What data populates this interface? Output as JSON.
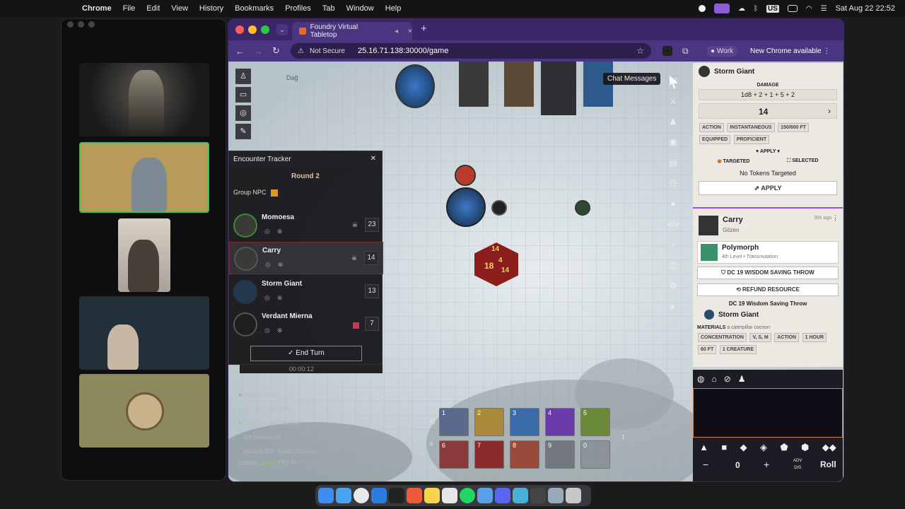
{
  "menubar": {
    "app": "Chrome",
    "items": [
      "File",
      "Edit",
      "View",
      "History",
      "Bookmarks",
      "Profiles",
      "Tab",
      "Window",
      "Help"
    ],
    "datetime": "Sat Aug 22  22:52",
    "input_source": "US"
  },
  "browser": {
    "tab_title": "Foundry Virtual Tabletop",
    "security": "Not Secure",
    "url": "25.16.71.138:30000/game",
    "profile": "Work",
    "update_label": "New Chrome available"
  },
  "tooltip": "Chat Messages",
  "encounter_tracker": {
    "title": "Encounter Tracker",
    "round": "Round 2",
    "group_label": "Group NPC",
    "combatants": [
      {
        "name": "Momoesa",
        "initiative": "23"
      },
      {
        "name": "Carry",
        "initiative": "14"
      },
      {
        "name": "Storm Giant",
        "initiative": "13"
      },
      {
        "name": "Verdant Mierna",
        "initiative": "7"
      }
    ],
    "end_turn": "End Turn"
  },
  "timer_text": "00:00:12",
  "players": [
    "Gözen [Carry]",
    "Gamemaster [GM]",
    "Enes [Verdant Mierna]",
    "Eril [Momoesa]",
    "Mustafa [Eril \"Koala\" Duncan]"
  ],
  "latency": {
    "label": "Latency",
    "value": "196ms",
    "fps_label": "FPS",
    "fps": "44"
  },
  "hotbar": {
    "top": [
      "1",
      "2",
      "3",
      "4",
      "5"
    ],
    "bottom": [
      "6",
      "7",
      "8",
      "9",
      "0"
    ],
    "page": "1"
  },
  "dice_faces": [
    "14",
    "18",
    "4",
    "14"
  ],
  "map_label": "Dağ",
  "chat": {
    "damage_card": {
      "title": "Storm Giant",
      "damage_label": "DAMAGE",
      "formula": "1d8 + 2 + 1 + 5 + 2",
      "total": "14",
      "tags1": [
        "ACTION",
        "INSTANTANEOUS",
        "150/600 FT"
      ],
      "tags2": [
        "EQUIPPED",
        "PROFICIENT"
      ],
      "apply_menu": "APPLY",
      "targeted": "TARGETED",
      "selected": "SELECTED",
      "no_tokens": "No Tokens Targeted",
      "apply_button": "APPLY"
    },
    "spell_card": {
      "speaker": "Carry",
      "sub": "Gözen",
      "time": "39s ago",
      "spell": "Polymorph",
      "level": "4th Level • Transmutation",
      "save_button": "DC 19 WISDOM SAVING THROW",
      "refund_button": "REFUND RESOURCE",
      "save_result": "DC 19 Wisdom Saving Throw",
      "target": "Storm Giant",
      "materials_label": "MATERIALS",
      "materials": "a caterpillar cocoon",
      "tags1": [
        "CONCENTRATION",
        "V, S, M",
        "ACTION",
        "1 HOUR"
      ],
      "tags2": [
        "60 FT",
        "1 CREATURE"
      ]
    }
  },
  "dice_tray": {
    "count": "0",
    "adv": "ADV",
    "dis": "DIS",
    "roll": "Roll",
    "minus": "−",
    "plus": "+"
  },
  "colors": {
    "accent": "#a24be0",
    "chrome_bg": "#3a2769",
    "tracker_active": "#c0392b",
    "orange_border": "#e07b39"
  }
}
